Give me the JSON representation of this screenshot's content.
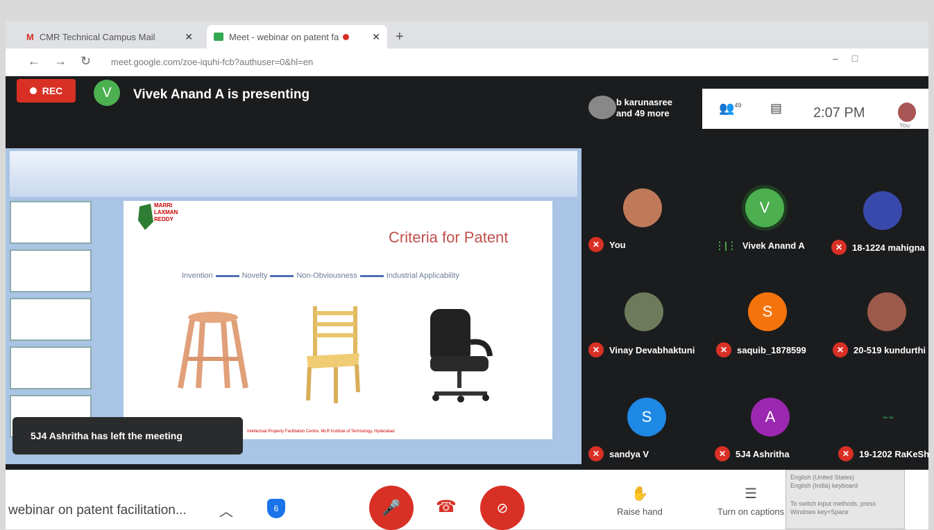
{
  "browser": {
    "tab1_title": "CMR Technical Campus Mail",
    "tab2_title": "Meet - webinar on patent fa",
    "url": "meet.google.com/zoe-iquhi-fcb?authuser=0&hl=en"
  },
  "meet_header": {
    "rec_label": "REC",
    "presenter_initial": "V",
    "presenting_text": "Vivek Anand A is presenting",
    "people_line1": "b karunasree",
    "people_line2": "and 49 more",
    "people_count": "49",
    "clock": "2:07 PM",
    "self_label": "You"
  },
  "slide": {
    "title": "Criteria for Patent",
    "logo_lines": [
      "MARRI",
      "LAXMAN",
      "REDDY"
    ],
    "flow": [
      "Invention",
      "Novelty",
      "Non-Obviousness",
      "Industrial Applicability"
    ],
    "footer": "Intellectual Property Facilitation Centre, MLR Institute of Technology, Hyderabad"
  },
  "participants": [
    {
      "name": "You",
      "initial": "",
      "color": "#c07a5a",
      "state": "muted"
    },
    {
      "name": "Vivek Anand A",
      "initial": "V",
      "color": "#4caf50",
      "state": "speaking"
    },
    {
      "name": "18-1224 mahigna",
      "initial": "",
      "color": "#3949ab",
      "state": "muted"
    },
    {
      "name": "Vinay Devabhaktuni",
      "initial": "",
      "color": "#6d7b5a",
      "state": "muted"
    },
    {
      "name": "saquib_1878599",
      "initial": "S",
      "color": "#f4730b",
      "state": "muted"
    },
    {
      "name": "20-519 kundurthi",
      "initial": "",
      "color": "#9c5a4a",
      "state": "muted"
    },
    {
      "name": "sandya V",
      "initial": "S",
      "color": "#1e88e5",
      "state": "muted"
    },
    {
      "name": "5J4 Ashritha",
      "initial": "A",
      "color": "#9c27b0",
      "state": "muted"
    },
    {
      "name": "19-1202 RaKeSh",
      "initial": "",
      "color": "#1b1c1e",
      "state": "muted"
    }
  ],
  "toast": "5J4 Ashritha has left the meeting",
  "bottom": {
    "meeting_name": "webinar on patent facilitation...",
    "raise_hand": "Raise hand",
    "captions": "Turn on captions",
    "ime_lines": [
      "English (United States)",
      "English (India) keyboard",
      "To switch input methods, press",
      "Windows key+Space"
    ]
  }
}
